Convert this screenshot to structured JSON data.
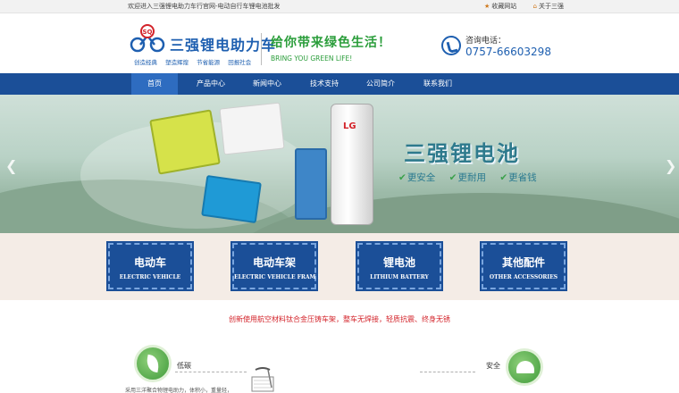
{
  "topbar": {
    "welcome": "欢迎进入三强锂电助力车行官网-电动自行车锂电池批发",
    "favorite": "收藏网站",
    "about": "关于三强"
  },
  "header": {
    "brand": "三强锂电助力车",
    "logo_badge": "SQ",
    "tagline": [
      "创造经典",
      "塑造辉煌",
      "节省能源",
      "回报社会"
    ],
    "slogan_cn": "给你带来绿色生活！",
    "slogan_en": "BRING YOU GREEN LIFE!",
    "phone_label": "咨询电话：",
    "phone_number": "0757-66603298"
  },
  "nav": {
    "items": [
      {
        "label": "首页",
        "active": true
      },
      {
        "label": "产品中心",
        "active": false
      },
      {
        "label": "新闻中心",
        "active": false
      },
      {
        "label": "技术支持",
        "active": false
      },
      {
        "label": "公司简介",
        "active": false
      },
      {
        "label": "联系我们",
        "active": false
      }
    ]
  },
  "banner": {
    "title": "三强锂电池",
    "features": [
      "更安全",
      "更耐用",
      "更省钱"
    ],
    "battery_brand": "LG",
    "prev_icon": "chevron-left-icon",
    "next_icon": "chevron-right-icon"
  },
  "categories": [
    {
      "cn": "电动车",
      "en": "ELECTRIC VEHICLE"
    },
    {
      "cn": "电动车架",
      "en": "ELECTRIC VEHICLE FRAME"
    },
    {
      "cn": "锂电池",
      "en": "LITHIUM BATTERY"
    },
    {
      "cn": "其他配件",
      "en": "OTHER ACCESSORIES"
    }
  ],
  "intro": "创新使用航空材料钛合金压铸车架，整车无焊接，轻质抗震、终身无锈",
  "features_row": {
    "left_label": "低碳",
    "left_desc": "采用三洋聚合物锂电助力，体积小，重量轻，",
    "right_label": "安全"
  },
  "colors": {
    "nav": "#1b4f98",
    "brand_blue": "#1e5fb0",
    "slogan_green": "#2a9d3a",
    "intro_red": "#d3232a"
  }
}
